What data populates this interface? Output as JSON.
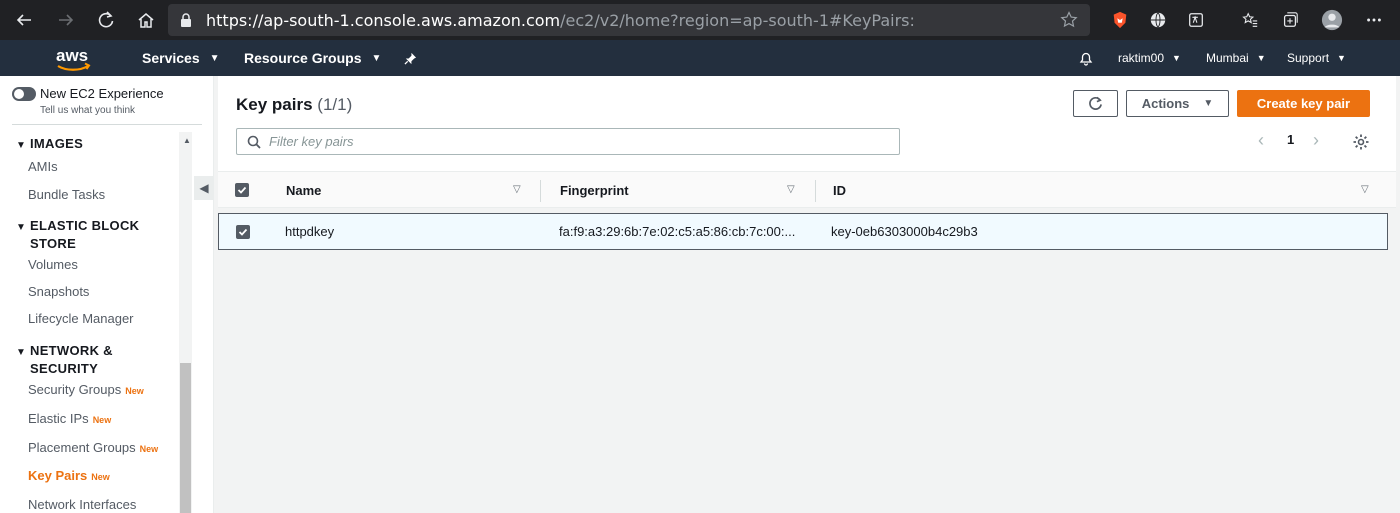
{
  "browser": {
    "url_host": "https://ap-south-1.console.aws.amazon.com",
    "url_path": "/ec2/v2/home?region=ap-south-1#KeyPairs:"
  },
  "aws_nav": {
    "services_label": "Services",
    "resource_groups_label": "Resource Groups",
    "user_label": "raktim00",
    "region_label": "Mumbai",
    "support_label": "Support"
  },
  "sidebar": {
    "toggle_label": "New EC2 Experience",
    "toggle_sub": "Tell us what you think",
    "sections": [
      {
        "heading": "IMAGES",
        "items": [
          "AMIs",
          "Bundle Tasks"
        ]
      },
      {
        "heading": "ELASTIC BLOCK STORE",
        "items": [
          "Volumes",
          "Snapshots",
          "Lifecycle Manager"
        ]
      },
      {
        "heading": "NETWORK & SECURITY",
        "items": [
          "Security Groups",
          "Elastic IPs",
          "Placement Groups",
          "Key Pairs",
          "Network Interfaces"
        ]
      }
    ],
    "heading_line2": {
      "ebs": "STORE",
      "net": "SECURITY"
    },
    "heading_line1": {
      "ebs": "ELASTIC BLOCK",
      "net": "NETWORK &"
    },
    "new_badge": "New"
  },
  "main": {
    "title": "Key pairs",
    "count": "(1/1)",
    "actions_label": "Actions",
    "create_label": "Create key pair",
    "filter_placeholder": "Filter key pairs",
    "page_number": "1",
    "columns": [
      "Name",
      "Fingerprint",
      "ID"
    ],
    "rows": [
      {
        "name": "httpdkey",
        "fingerprint": "fa:f9:a3:29:6b:7e:02:c5:a5:86:cb:7c:00:...",
        "id": "key-0eb6303000b4c29b3",
        "selected": true
      }
    ]
  },
  "colors": {
    "aws_nav_bg": "#232f3e",
    "accent_orange": "#ec7211",
    "browser_bg": "#202124"
  }
}
